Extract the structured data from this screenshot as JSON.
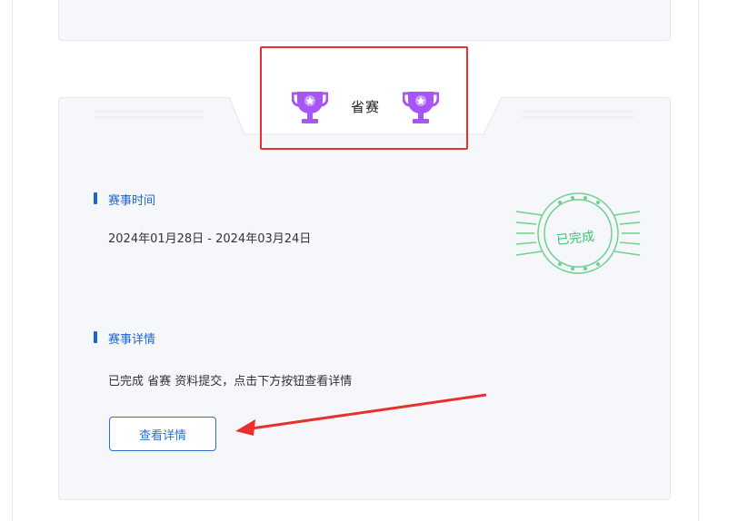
{
  "competition": {
    "level_title": "省赛",
    "status_stamp": "已完成",
    "time_section": {
      "title": "赛事时间",
      "range": "2024年01月28日 - 2024年03月24日"
    },
    "detail_section": {
      "title": "赛事详情",
      "description": "已完成 省赛 资料提交，点击下方按钮查看详情"
    },
    "button_label": "查看详情"
  },
  "colors": {
    "accent": "#1e63d6",
    "trophy": "#a855f7",
    "stamp": "#3fbf6e",
    "annotation": "#e8312e"
  },
  "icons": [
    "trophy-icon",
    "completed-stamp",
    "annotation-arrow"
  ]
}
